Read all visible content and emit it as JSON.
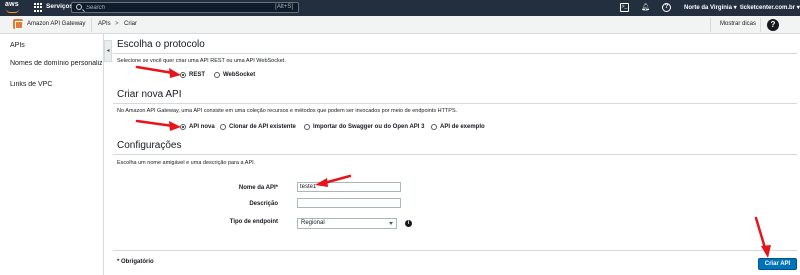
{
  "topnav": {
    "logo_text": "aws",
    "services_label": "Serviços",
    "search_placeholder": "Search",
    "search_shortcut": "[Alt+S]",
    "region": "Norte da Virgínia ▾",
    "account": "ticketcenter.com.br ▾"
  },
  "service_header": {
    "name": "Amazon API Gateway",
    "breadcrumb": [
      "APIs",
      ">",
      "Criar"
    ],
    "hints_label": "Mostrar dicas",
    "help_glyph": "?"
  },
  "sidebar": {
    "items": [
      {
        "label": "APIs"
      },
      {
        "label": "Nomes de domínio personalizados"
      },
      {
        "label": "Links de VPC"
      }
    ],
    "collapse_glyph": "◂"
  },
  "protocol": {
    "title": "Escolha o protocolo",
    "description": "Selecione se você quer criar uma API REST ou uma API WebSocket.",
    "options": [
      {
        "label": "REST",
        "selected": true
      },
      {
        "label": "WebSocket",
        "selected": false
      }
    ]
  },
  "new_api": {
    "title": "Criar nova API",
    "description": "No Amazon API Gateway, uma API consiste em uma coleção recursos e métodos que podem ser invocados por meio de endpoints HTTPS.",
    "options": [
      {
        "label": "API nova",
        "selected": true
      },
      {
        "label": "Clonar de API existente",
        "selected": false
      },
      {
        "label": "Importar do Swagger ou do Open API 3",
        "selected": false
      },
      {
        "label": "API de exemplo",
        "selected": false
      }
    ]
  },
  "settings": {
    "title": "Configurações",
    "description": "Escolha um nome amigável e uma descrição para a API.",
    "api_name_label": "Nome da API*",
    "api_name_value": "teste1",
    "description_label": "Descrição",
    "description_value": "",
    "endpoint_label": "Tipo de endpoint",
    "endpoint_value": "Regional",
    "info_glyph": "i"
  },
  "footer": {
    "required_note": "* Obrigatório",
    "create_button": "Criar API"
  },
  "colors": {
    "topnav_bg": "#232f3e",
    "accent_orange": "#ff9900",
    "primary_button": "#0073bb",
    "annotation_red": "#e8141b"
  }
}
